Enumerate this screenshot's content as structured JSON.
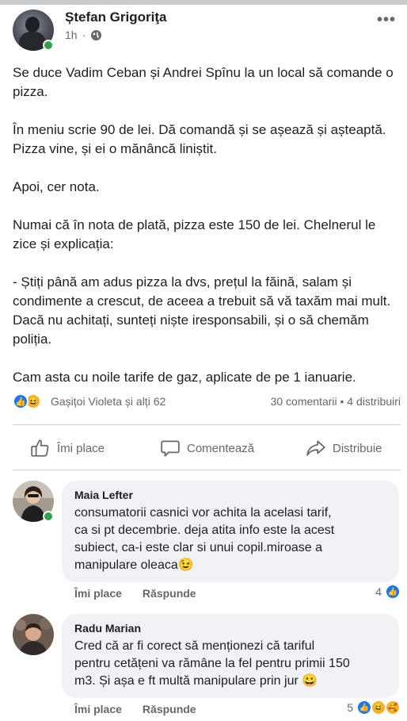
{
  "post": {
    "author": "Ștefan Grigoriţa",
    "time": "1h",
    "more": "•••",
    "paragraphs": [
      "Se duce Vadim Ceban și Andrei Spînu la un local să comande o pizza.",
      "În meniu scrie 90 de lei. Dă comandă și se așează și așteaptă. Pizza vine, și ei o mănâncă liniștit.",
      "Apoi, cer nota.",
      "Numai că în nota de plată, pizza este 150 de lei. Chelnerul le zice și explicația:",
      "- Știți până am adus pizza la dvs, prețul la făină, salam și condimente a crescut, de aceea a trebuit să vă taxăm mai mult. Dacă nu achitați, sunteți niște iresponsabili, și o să chemăm poliția.",
      "Cam asta cu noile tarife de gaz, aplicate de pe 1 ianuarie."
    ],
    "reactions_text": "Gașițoi Violeta și alți 62",
    "counts_text": "30 comentarii • 4 distribuiri"
  },
  "actions": {
    "like": "Îmi place",
    "comment": "Comentează",
    "share": "Distribuie"
  },
  "comments": [
    {
      "name": "Maia Lefter",
      "lines": [
        "consumatorii casnici vor achita la acelasi tarif,",
        "ca si pt decembrie. deja atita info este la acest",
        "subiect, ca-i este clar si unui copil.miroase a",
        "manipulare oleaca😉"
      ],
      "like_label": "Îmi place",
      "reply_label": "Răspunde",
      "reaction_count": "4"
    },
    {
      "name": "Radu Marian",
      "lines": [
        "Cred că ar fi corect să menționezi că tariful",
        "pentru cetățeni va rămâne la fel pentru primii 150",
        "m3. Și așa e ft multă manipulare prin jur 😀"
      ],
      "like_label": "Îmi place",
      "reply_label": "Răspunde",
      "reaction_count": "5"
    }
  ],
  "colors": {
    "accent": "#1877f2",
    "online": "#31a24c",
    "secondary_text": "#65676b",
    "bubble": "#f0f2f5"
  },
  "icons": [
    "globe-icon",
    "more-icon",
    "like-reaction-icon",
    "haha-reaction-icon",
    "care-reaction-icon",
    "thumbs-up-icon",
    "comment-icon",
    "share-icon"
  ]
}
